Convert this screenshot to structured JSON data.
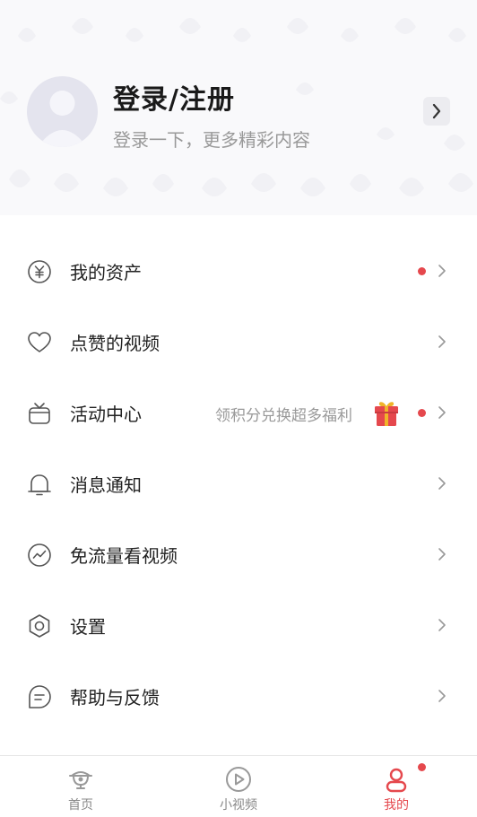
{
  "profile": {
    "title": "登录/注册",
    "subtitle": "登录一下，更多精彩内容"
  },
  "menu": [
    {
      "label": "我的资产",
      "icon": "yen-circle-icon",
      "dot": true
    },
    {
      "label": "点赞的视频",
      "icon": "heart-icon",
      "dot": false
    },
    {
      "label": "活动中心",
      "icon": "tv-icon",
      "dot": true,
      "hint": "领积分兑换超多福利",
      "badge_icon": "gift-icon"
    },
    {
      "label": "消息通知",
      "icon": "bell-icon",
      "dot": false
    },
    {
      "label": "免流量看视频",
      "icon": "trend-circle-icon",
      "dot": false
    },
    {
      "label": "设置",
      "icon": "hexagon-settings-icon",
      "dot": false
    },
    {
      "label": "帮助与反馈",
      "icon": "feedback-icon",
      "dot": false
    }
  ],
  "tabbar": [
    {
      "label": "首页",
      "icon": "home-icon",
      "active": false
    },
    {
      "label": "小视频",
      "icon": "play-circle-icon",
      "active": false
    },
    {
      "label": "我的",
      "icon": "user-icon",
      "active": true,
      "badge": true
    }
  ],
  "colors": {
    "accent": "#e5484d",
    "text": "#222222",
    "muted": "#999999",
    "header_bg": "#f9f9fb"
  }
}
